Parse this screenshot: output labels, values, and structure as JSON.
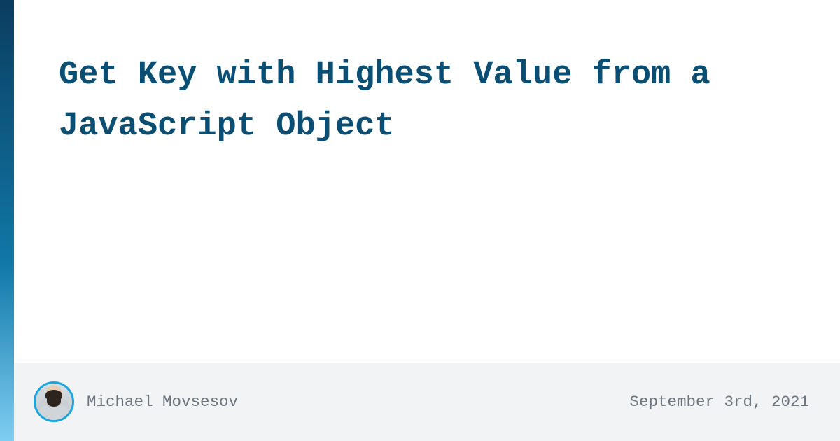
{
  "article": {
    "title": "Get Key with Highest Value from a JavaScript Object"
  },
  "author": {
    "name": "Michael Movsesov"
  },
  "meta": {
    "date": "September 3rd, 2021"
  }
}
